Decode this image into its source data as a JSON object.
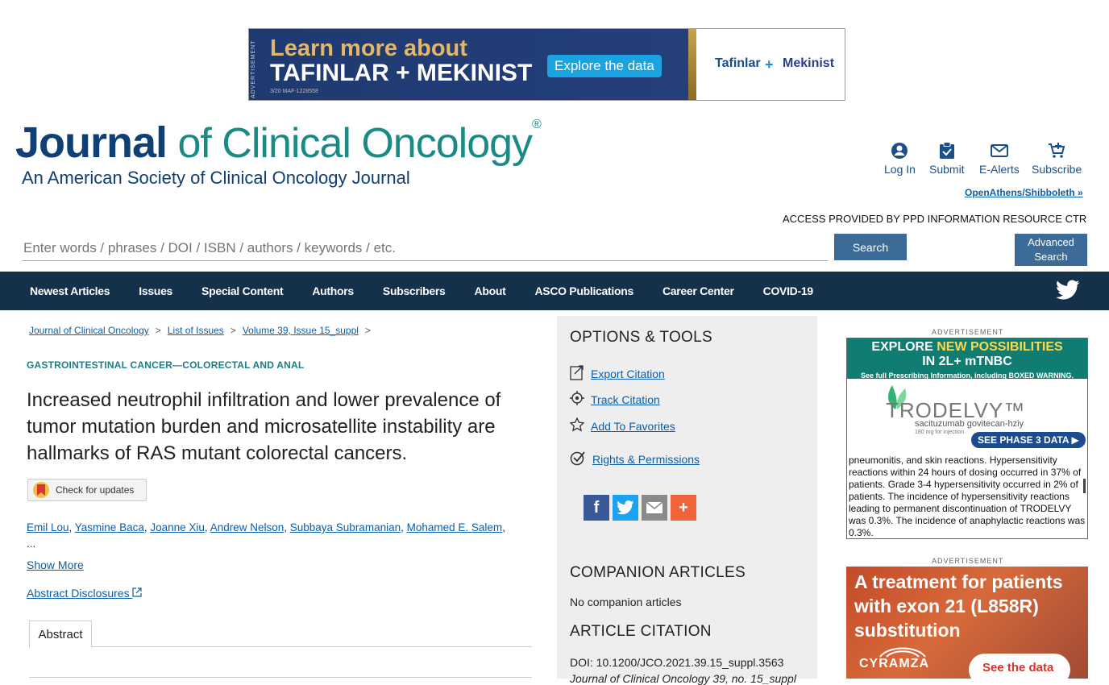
{
  "top_ad": {
    "vertical_label": "ADVERTISEMENT",
    "line1": "Learn more about",
    "line2": "TAFINLAR + MEKINIST",
    "cta": "Explore the data",
    "code": "3/20     MAF-1228558",
    "brand1": "Tafinlar",
    "plus": "+",
    "brand2": "Mekinist"
  },
  "logo": {
    "journal": "Journal",
    "rest": " of Clinical Oncology",
    "reg": "®",
    "subtitle": "An American Society of Clinical Oncology Journal"
  },
  "utility": {
    "login": "Log In",
    "submit": "Submit",
    "ealerts": "E-Alerts",
    "subscribe": "Subscribe",
    "openathens": "OpenAthens/Shibboleth »",
    "access": "ACCESS PROVIDED BY PPD INFORMATION RESOURCE CTR"
  },
  "search": {
    "placeholder": "Enter words / phrases / DOI / ISBN / authors / keywords / etc.",
    "button": "Search",
    "advanced": "Advanced Search"
  },
  "nav": {
    "items": [
      "Newest Articles",
      "Issues",
      "Special Content",
      "Authors",
      "Subscribers",
      "About",
      "ASCO Publications",
      "Career Center",
      "COVID-19"
    ]
  },
  "breadcrumb": {
    "items": [
      "Journal of Clinical Oncology",
      "List of Issues",
      "Volume 39, Issue 15_suppl"
    ],
    "separator": ">"
  },
  "article": {
    "section": "GASTROINTESTINAL CANCER—COLORECTAL AND ANAL",
    "title": "Increased neutrophil infiltration and lower prevalence of tumor mutation burden and microsatellite instability are hallmarks of RAS mutant colorectal cancers.",
    "check_updates": "Check for updates",
    "authors": [
      "Emil Lou",
      "Yasmine Baca",
      "Joanne Xiu",
      "Andrew Nelson",
      "Subbaya Subramanian",
      "Mohamed E. Salem"
    ],
    "ellipsis": "...",
    "show_more": "Show More",
    "abstract_disclosures": "Abstract Disclosures",
    "tab_abstract": "Abstract"
  },
  "sidebar": {
    "options_title": "OPTIONS & TOOLS",
    "export": "Export Citation",
    "track": "Track Citation",
    "favorites": "Add To Favorites",
    "rights": "Rights & Permissions",
    "companion_title": "COMPANION ARTICLES",
    "companion_text": "No companion articles",
    "citation_title": "ARTICLE CITATION",
    "doi": "DOI: 10.1200/JCO.2021.39.15_suppl.3563",
    "journal_cite": "Journal of Clinical Oncology 39, no. 15_suppl"
  },
  "right_ads": {
    "label": "ADVERTISEMENT",
    "ad1_h1a": "EXPLORE ",
    "ad1_h1b": "NEW POSSIBILITIES",
    "ad1_h1c": "IN 2L+ mTNBC",
    "ad1_h2a": "See full ",
    "ad1_h2link": "Prescribing Information",
    "ad1_h2b": ", including BOXED WARNING.",
    "ad1_brand": "TRODELVY™",
    "ad1_sub": "sacituzumab govitecan-hziy",
    "ad1_dose": "180 mg for injection",
    "ad1_cta": "SEE PHASE 3 DATA ▶",
    "ad1_body": "pneumonitis, and skin reactions. Hypersensitivity reactions within 24 hours of dosing occurred in 37% of patients. Grade 3-4 hypersensitivity occurred in 2% of patients. The incidence of hypersensitivity reactions leading to permanent discontinuation of TRODELVY was 0.3%. The incidence of anaphylactic reactions was 0.3%.",
    "ad2_text": "A treatment for patients with exon 21 (L858R) substitution",
    "ad2_brand": "CYRAMZA",
    "ad2_cta": "See the data"
  },
  "colors": {
    "navbar": "#14304a",
    "journal_blue": "#0f3f73",
    "journal_teal": "#1a8a85",
    "link": "#0b5ea8",
    "button": "#3b6b96"
  }
}
